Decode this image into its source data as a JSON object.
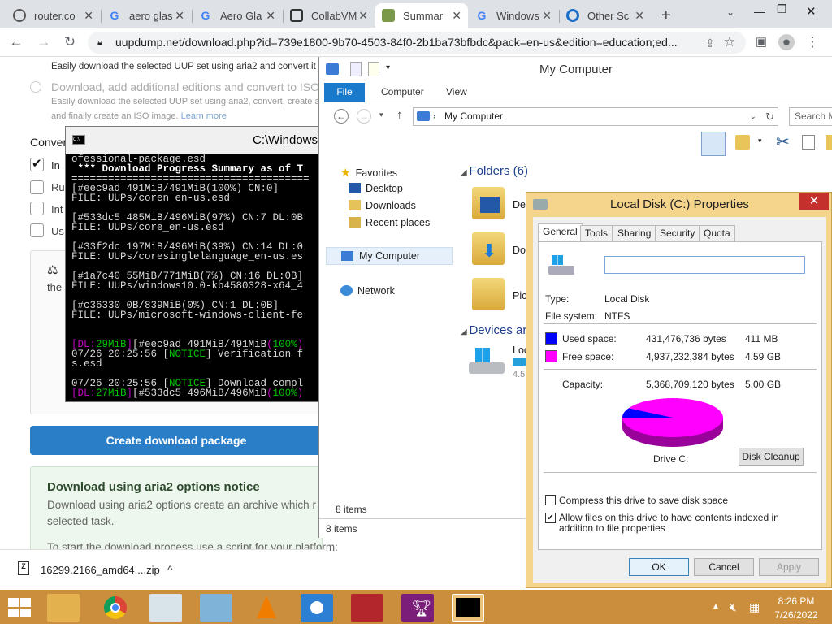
{
  "browser": {
    "tabs": [
      {
        "title": "router.co",
        "icon": "globe-icon"
      },
      {
        "title": "aero glas",
        "icon": "google-icon"
      },
      {
        "title": "Aero Gla",
        "icon": "google-icon"
      },
      {
        "title": "CollabVM",
        "icon": "collabvm-icon"
      },
      {
        "title": "Summar",
        "icon": "uupdump-icon"
      },
      {
        "title": "Windows",
        "icon": "google-icon"
      },
      {
        "title": "Other Sc",
        "icon": "disk-icon"
      }
    ],
    "new_tab": "+",
    "url": "uupdump.net/download.php?id=739e1800-9b70-4503-84f0-2b1ba73bfbdc&pack=en-us&edition=education;ed..."
  },
  "webpage": {
    "line1": "Easily download the selected UUP set using aria2 and convert it to IS",
    "option2_label": "Download, add additional editions and convert to ISO",
    "option2_desc1": "Easily download the selected UUP set using aria2, convert, create a",
    "option2_desc2": "and finally create an ISO image.",
    "learn_more": "Learn more",
    "conversion_heading": "Conver",
    "checkbox_labels": [
      "In",
      "Ru",
      "Int",
      "Us"
    ],
    "license_text": "the",
    "create_button": "Create download package",
    "notice_title": "Download using aria2 options notice",
    "notice_text1": "Download using aria2 options create an archive which r",
    "notice_text2": "selected task.",
    "notice_text3": "To start the download process use a script for your platform:"
  },
  "download_bar": {
    "filename": "16299.2166_amd64....zip",
    "chevron": "^"
  },
  "console": {
    "title": "C:\\Windows\\",
    "lines": [
      {
        "t": "ofessional-package.esd",
        "c": ""
      },
      {
        "t": " *** Download Progress Summary as of T",
        "c": "wht"
      },
      {
        "t": "=======================================",
        "c": ""
      },
      {
        "t": "[#eec9ad 491MiB/491MiB(100%) CN:0]",
        "c": ""
      },
      {
        "t": "FILE: UUPs/coren_en-us.esd",
        "c": ""
      },
      {
        "t": "",
        "c": ""
      },
      {
        "t": "[#533dc5 485MiB/496MiB(97%) CN:7 DL:0B",
        "c": ""
      },
      {
        "t": "FILE: UUPs/core_en-us.esd",
        "c": ""
      },
      {
        "t": "",
        "c": ""
      },
      {
        "t": "[#33f2dc 197MiB/496MiB(39%) CN:14 DL:0",
        "c": ""
      },
      {
        "t": "FILE: UUPs/coresinglelanguage_en-us.es",
        "c": ""
      },
      {
        "t": "",
        "c": ""
      },
      {
        "t": "[#1a7c40 55MiB/771MiB(7%) CN:16 DL:0B]",
        "c": ""
      },
      {
        "t": "FILE: UUPs/windows10.0-kb4580328-x64_4",
        "c": ""
      },
      {
        "t": "",
        "c": ""
      },
      {
        "t": "[#c36330 0B/839MiB(0%) CN:1 DL:0B]",
        "c": ""
      },
      {
        "t": "FILE: UUPs/microsoft-windows-client-fe",
        "c": ""
      },
      {
        "t": "",
        "c": ""
      },
      {
        "t": "",
        "c": ""
      },
      {
        "t": "[DL:29MiB][#eec9ad 491MiB/491MiB(100%)",
        "c": "mix1"
      },
      {
        "t": "07/26 20:25:56 [NOTICE] Verification f",
        "c": "mix2"
      },
      {
        "t": "s.esd",
        "c": ""
      },
      {
        "t": "",
        "c": ""
      },
      {
        "t": "07/26 20:25:56 [NOTICE] Download compl",
        "c": "mix2"
      },
      {
        "t": "[DL:27MiB][#533dc5 496MiB/496MiB(100%)",
        "c": "mix1"
      }
    ]
  },
  "explorer": {
    "title": "My Computer",
    "ribbon_tabs": [
      "File",
      "Computer",
      "View"
    ],
    "address": "My Computer",
    "search_placeholder": "Search M",
    "nav": {
      "favorites": "Favorites",
      "fav_items": [
        "Desktop",
        "Downloads",
        "Recent places"
      ],
      "my_computer": "My Computer",
      "network": "Network"
    },
    "folders_heading": "Folders (6)",
    "folder_labels": [
      "Des",
      "Dow",
      "Pict"
    ],
    "devices_heading": "Devices ar",
    "drive_label": "Loca",
    "drive_free": "4.5",
    "status_items": "8 items",
    "status_items2": "8 items"
  },
  "properties": {
    "title": "Local Disk (C:) Properties",
    "close": "✕",
    "tabs": [
      "General",
      "Tools",
      "Sharing",
      "Security",
      "Quota"
    ],
    "name_value": "",
    "type_label": "Type:",
    "type_value": "Local Disk",
    "fs_label": "File system:",
    "fs_value": "NTFS",
    "used_label": "Used space:",
    "used_bytes": "431,476,736 bytes",
    "used_h": "411 MB",
    "free_label": "Free space:",
    "free_bytes": "4,937,232,384 bytes",
    "free_h": "4.59 GB",
    "cap_label": "Capacity:",
    "cap_bytes": "5,368,709,120 bytes",
    "cap_h": "5.00 GB",
    "used_fraction": 0.0804,
    "drive_label": "Drive C:",
    "cleanup": "Disk Cleanup",
    "compress_label": "Compress this drive to save disk space",
    "compress_checked": false,
    "index_label": "Allow files on this drive to have contents indexed in addition to file properties",
    "index_checked": true,
    "ok": "OK",
    "cancel": "Cancel",
    "apply": "Apply",
    "used_color": "#0000ff",
    "free_color": "#ff00ff"
  },
  "taskbar": {
    "time": "8:26 PM",
    "date": "7/26/2022",
    "apps": [
      "file-explorer-icon",
      "chrome-icon",
      "task-manager-icon",
      "control-panel-icon",
      "vlc-icon",
      "settings-icon",
      "news-icon",
      "trophy-icon",
      "console-icon"
    ]
  }
}
